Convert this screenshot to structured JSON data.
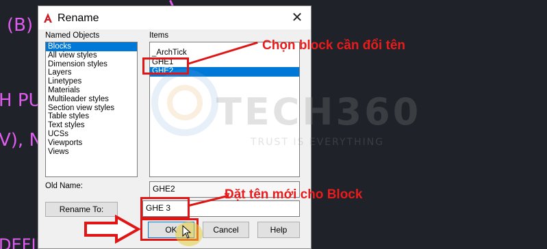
{
  "background": {
    "texts": [
      "(B)",
      "H PU",
      "V), N",
      "DEFINITION (ATD"
    ]
  },
  "watermark": {
    "main": "TECH360",
    "sub": "TRUST IS EVERYTHING"
  },
  "dialog": {
    "title": "Rename",
    "close": "✕",
    "named_objects_label": "Named Objects",
    "named_objects": [
      {
        "label": "Blocks",
        "selected": true
      },
      {
        "label": "All view styles",
        "selected": false
      },
      {
        "label": "Dimension styles",
        "selected": false
      },
      {
        "label": "Layers",
        "selected": false
      },
      {
        "label": "Linetypes",
        "selected": false
      },
      {
        "label": "Materials",
        "selected": false
      },
      {
        "label": "Multileader styles",
        "selected": false
      },
      {
        "label": "Section view styles",
        "selected": false
      },
      {
        "label": "Table styles",
        "selected": false
      },
      {
        "label": "Text styles",
        "selected": false
      },
      {
        "label": "UCSs",
        "selected": false
      },
      {
        "label": "Viewports",
        "selected": false
      },
      {
        "label": "Views",
        "selected": false
      }
    ],
    "items_label": "Items",
    "items": [
      {
        "label": "_ArchTick",
        "selected": false
      },
      {
        "label": "GHE1",
        "selected": false
      },
      {
        "label": "GHE2",
        "selected": true
      }
    ],
    "old_name_label": "Old Name:",
    "old_name_value": "GHE2",
    "rename_to_label": "Rename To:",
    "new_name_value": "GHE 3",
    "ok_label": "OK",
    "cancel_label": "Cancel",
    "help_label": "Help"
  },
  "annotations": {
    "select_block": "Chọn block cần đổi tên",
    "new_name": "Đặt tên mới cho Block"
  },
  "colors": {
    "annotation_red": "#e01616",
    "selection_blue": "#0078d7",
    "cad_magenta": "#e05cf0"
  }
}
